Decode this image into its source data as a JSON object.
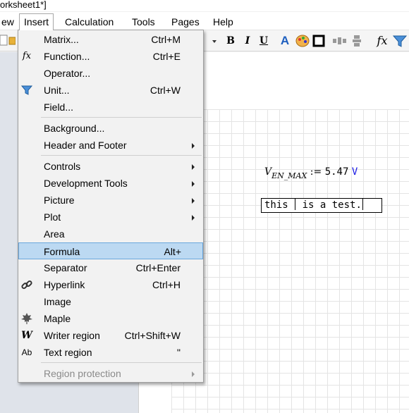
{
  "window": {
    "title_fragment": "orksheet1*]"
  },
  "menubar": {
    "items": [
      "ew",
      "Insert",
      "Calculation",
      "Tools",
      "Pages",
      "Help"
    ]
  },
  "toolbar": {
    "bold": "B",
    "italic": "I",
    "underline": "U",
    "font_color": "A",
    "function": "fx"
  },
  "insert_menu": {
    "items": [
      {
        "label": "Matrix...",
        "shortcut": "Ctrl+M",
        "icon": "matrix-icon"
      },
      {
        "label": "Function...",
        "shortcut": "Ctrl+E",
        "icon": "function-icon",
        "glyph": "fx"
      },
      {
        "label": "Operator...",
        "shortcut": "",
        "icon": ""
      },
      {
        "label": "Unit...",
        "shortcut": "Ctrl+W",
        "icon": "funnel-icon"
      },
      {
        "label": "Field...",
        "shortcut": "",
        "icon": ""
      },
      {
        "label": "Background...",
        "shortcut": "",
        "icon": ""
      },
      {
        "label": "Header and Footer",
        "shortcut": "",
        "submenu": true
      },
      {
        "label": "Controls",
        "shortcut": "",
        "submenu": true
      },
      {
        "label": "Development Tools",
        "shortcut": "",
        "submenu": true
      },
      {
        "label": "Picture",
        "shortcut": "",
        "submenu": true
      },
      {
        "label": "Plot",
        "shortcut": "",
        "submenu": true
      },
      {
        "label": "Area",
        "shortcut": ""
      },
      {
        "label": "Formula",
        "shortcut": "Alt+",
        "highlighted": true
      },
      {
        "label": "Separator",
        "shortcut": "Ctrl+Enter"
      },
      {
        "label": "Hyperlink",
        "shortcut": "Ctrl+H",
        "icon": "link-icon"
      },
      {
        "label": "Image",
        "shortcut": ""
      },
      {
        "label": "Maple",
        "shortcut": "",
        "icon": "maple-leaf-icon"
      },
      {
        "label": "Writer region",
        "shortcut": "Ctrl+Shift+W",
        "icon": "writer-icon",
        "glyph": "W"
      },
      {
        "label": "Text region",
        "shortcut": "\"",
        "icon": "text-region-icon",
        "glyph": "Ab"
      },
      {
        "label": "Region protection",
        "shortcut": "",
        "submenu": true,
        "disabled": true
      }
    ]
  },
  "worksheet": {
    "formula": {
      "var": "V",
      "subscript": "EN_MAX",
      "assign": ":=",
      "value": "5.47",
      "unit": "V"
    },
    "text_region": {
      "before": "this ",
      "after": " is a test."
    }
  }
}
